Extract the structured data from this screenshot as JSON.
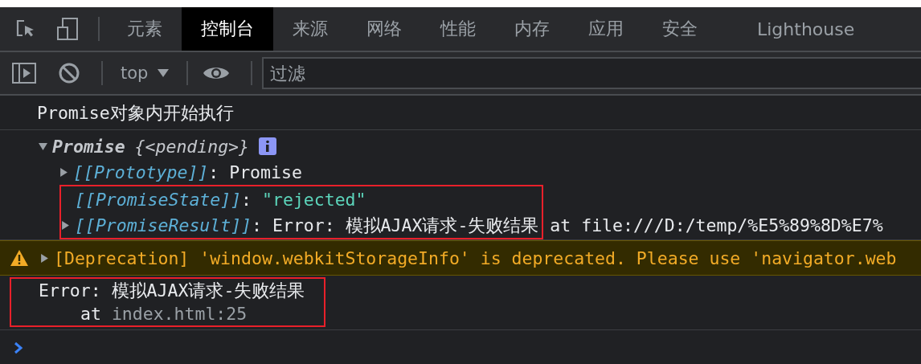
{
  "tabs": [
    {
      "label": "元素",
      "selected": false
    },
    {
      "label": "控制台",
      "selected": true
    },
    {
      "label": "来源",
      "selected": false
    },
    {
      "label": "网络",
      "selected": false
    },
    {
      "label": "性能",
      "selected": false
    },
    {
      "label": "内存",
      "selected": false
    },
    {
      "label": "应用",
      "selected": false
    },
    {
      "label": "安全",
      "selected": false
    },
    {
      "label": "Lighthouse",
      "selected": false
    }
  ],
  "toolbar": {
    "context": "top",
    "filter": {
      "placeholder": "过滤"
    }
  },
  "console": [
    {
      "kind": "log",
      "text": "Promise对象内开始执行"
    },
    {
      "kind": "object",
      "expanded": true,
      "name": "Promise",
      "preview": "{<pending>}",
      "properties": [
        {
          "key": "[[Prototype]]",
          "separator": ":",
          "value": "Promise",
          "kind": "object",
          "expandable": true,
          "highlighted": false
        },
        {
          "key": "[[PromiseState]]",
          "separator": ":",
          "value": "\"rejected\"",
          "kind": "string",
          "expandable": false,
          "highlighted": true
        },
        {
          "key": "[[PromiseResult]]",
          "separator": ":",
          "value": "Error: 模拟AJAX请求-失败结果",
          "trailing": "at file:///D:/temp/%E5%89%8D%E7%",
          "kind": "object",
          "expandable": true,
          "highlighted": true
        }
      ]
    },
    {
      "kind": "warning",
      "expanded": false,
      "text": "[Deprecation] 'window.webkitStorageInfo' is deprecated. Please use 'navigator.web"
    },
    {
      "kind": "error",
      "highlighted": true,
      "message": "Error: 模拟AJAX请求-失败结果",
      "stack_prefix": "at",
      "stack_link": "index.html:25"
    }
  ]
}
